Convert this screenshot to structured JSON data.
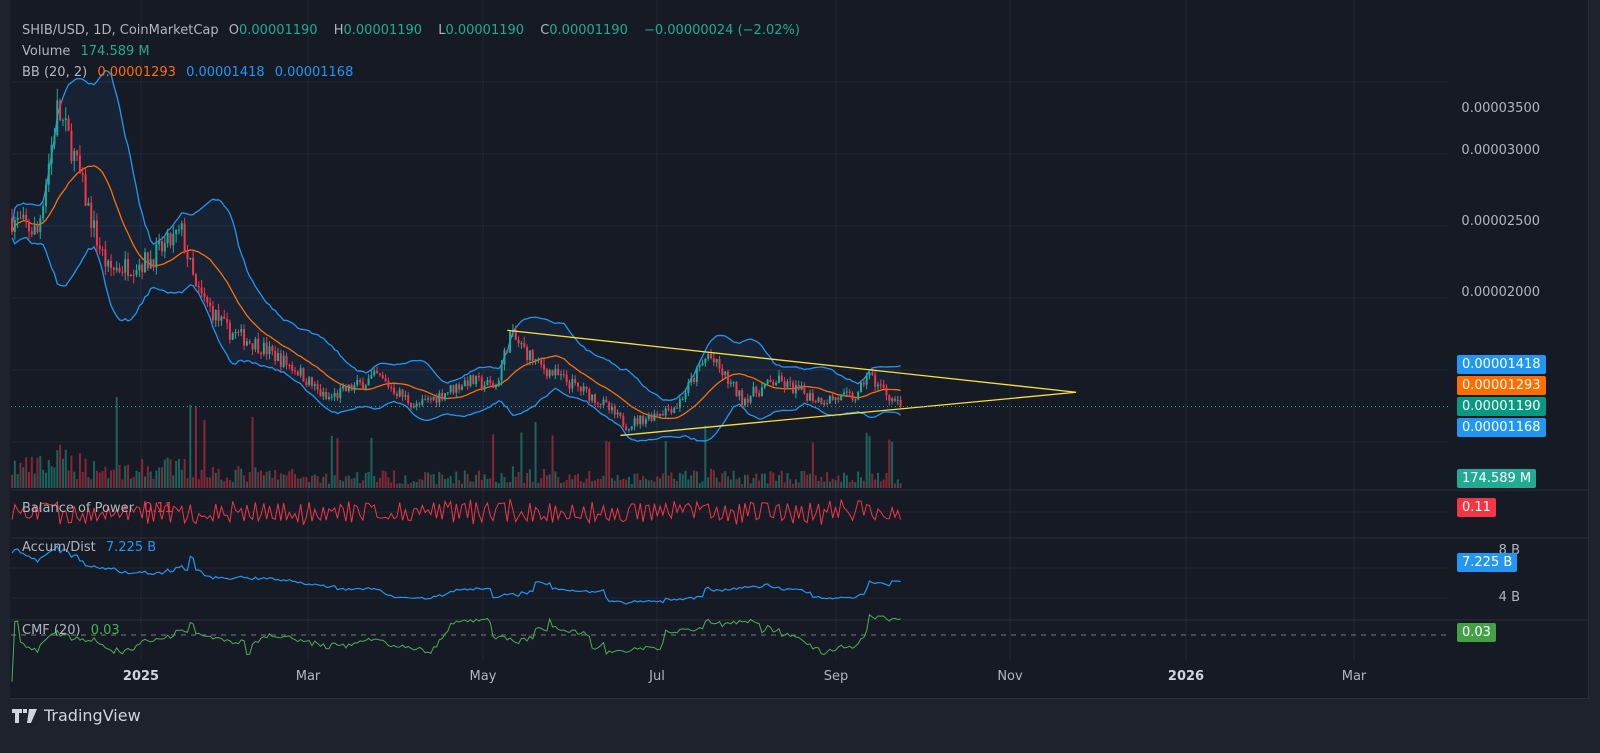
{
  "legend": {
    "symbol": "SHIB/USD, 1D, CoinMarketCap",
    "o_label": "O",
    "o_value": "0.00001190",
    "h_label": "H",
    "h_value": "0.00001190",
    "l_label": "L",
    "l_value": "0.00001190",
    "c_label": "C",
    "c_value": "0.00001190",
    "change": "−0.00000024 (−2.02%)",
    "volume_label": "Volume",
    "volume_value": "174.589 M",
    "bb_label": "BB (20, 2)",
    "bb_basis": "0.00001293",
    "bb_upper": "0.00001418",
    "bb_lower": "0.00001168"
  },
  "indicators": {
    "bop_label": "Balance of Power",
    "bop_value": "0.11",
    "ad_label": "Accum/Dist",
    "ad_value": "7.225 B",
    "cmf_label": "CMF (20)",
    "cmf_value": "0.03"
  },
  "price_axis": [
    "0.00003500",
    "0.00003000",
    "0.00002500",
    "0.00002000"
  ],
  "ad_axis": [
    "8 B",
    "4 B"
  ],
  "tags": {
    "bb_upper": "0.00001418",
    "bb_basis": "0.00001293",
    "last_price": "0.00001190",
    "bb_lower": "0.00001168",
    "volume": "174.589 M",
    "bop": "0.11",
    "ad": "7.225 B",
    "cmf": "0.03"
  },
  "time_axis": [
    {
      "label": "2025",
      "bold": true
    },
    {
      "label": "Mar",
      "bold": false
    },
    {
      "label": "May",
      "bold": false
    },
    {
      "label": "Jul",
      "bold": false
    },
    {
      "label": "Sep",
      "bold": false
    },
    {
      "label": "Nov",
      "bold": false
    },
    {
      "label": "2026",
      "bold": true
    },
    {
      "label": "Mar",
      "bold": false
    }
  ],
  "brand": "TradingView",
  "colors": {
    "up": "#22ab94",
    "down": "#f23645",
    "bb_band": "#2196f3",
    "bb_basis": "#ff6d00",
    "trendline": "#f7e03c",
    "bop": "#f23645",
    "ad": "#2196f3",
    "cmf": "#4caf50"
  },
  "chart_data": {
    "type": "candlestick",
    "title": "SHIB/USD, 1D, CoinMarketCap",
    "price_unit": "1e-6 USD",
    "start_date": "2024-11-17",
    "total_days": 315,
    "price_path_approx": [
      [
        0,
        25
      ],
      [
        10,
        24
      ],
      [
        17,
        32.5
      ],
      [
        22,
        30
      ],
      [
        31,
        23.5
      ],
      [
        35,
        21.4
      ],
      [
        49,
        22
      ],
      [
        61,
        24
      ],
      [
        66,
        20
      ],
      [
        77,
        17.2
      ],
      [
        88,
        16.2
      ],
      [
        102,
        14.4
      ],
      [
        112,
        12.4
      ],
      [
        130,
        14
      ],
      [
        144,
        11.9
      ],
      [
        162,
        13.7
      ],
      [
        172,
        13.3
      ],
      [
        177,
        16.9
      ],
      [
        187,
        14.8
      ],
      [
        208,
        12.4
      ],
      [
        218,
        10.6
      ],
      [
        236,
        12
      ],
      [
        247,
        15.5
      ],
      [
        259,
        12.4
      ],
      [
        271,
        13.7
      ],
      [
        286,
        12.4
      ],
      [
        300,
        12.6
      ],
      [
        303,
        14.2
      ],
      [
        315,
        11.9
      ]
    ],
    "ylim": [
      8,
      36
    ],
    "trendlines": [
      {
        "name": "upper",
        "from": [
          175,
          17.2
        ],
        "to": [
          376,
          12.9
        ]
      },
      {
        "name": "lower",
        "from": [
          215,
          9.9
        ],
        "to": [
          376,
          12.9
        ]
      }
    ],
    "bollinger": {
      "period": 20,
      "mult": 2
    }
  }
}
